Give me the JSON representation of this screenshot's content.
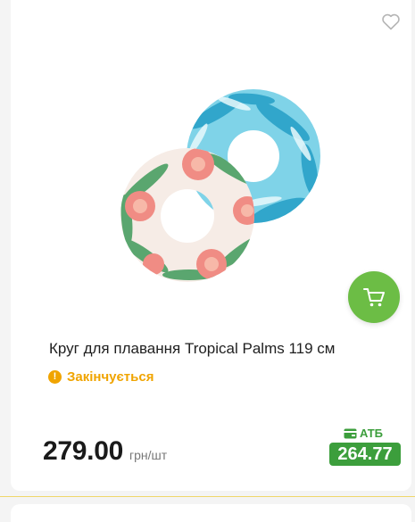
{
  "product": {
    "title": "Круг для плавання Tropical Palms 119 см",
    "image_icon": "swim-rings-image",
    "status": "Закінчується",
    "price": "279.00",
    "price_unit": "грн/шт",
    "promo_label": "АТБ",
    "promo_price": "264.77"
  },
  "colors": {
    "accent_green": "#6cbd45",
    "promo_green": "#3c9e3c",
    "status_orange": "#f0a400"
  },
  "icons": {
    "favorite": "heart-icon",
    "cart": "cart-icon",
    "status": "exclamation-icon",
    "promo": "card-icon"
  }
}
